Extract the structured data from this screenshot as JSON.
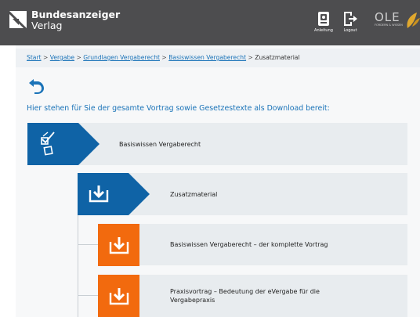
{
  "header": {
    "brand_line1": "Bundesanzeiger",
    "brand_line2": "Verlag",
    "anleitung_label": "Anleitung",
    "logout_label": "Logout",
    "ole_text": "OLE",
    "ole_sub": "FORDERN & WISSEN"
  },
  "breadcrumb": {
    "start": "Start",
    "vergabe": "Vergabe",
    "grundlagen": "Grundlagen Vergaberecht",
    "basiswissen": "Basiswissen Vergaberecht",
    "current": "Zusatzmaterial",
    "separator": ">"
  },
  "intro_text": "Hier stehen für Sie der gesamte Vortrag sowie Gesetzestexte als Download bereit:",
  "tree": {
    "level1_label": "Basiswissen Vergaberecht",
    "level2_label": "Zusatzmaterial",
    "items": [
      {
        "label": "Basiswissen Vergaberecht – der komplette Vortrag"
      },
      {
        "label": "Praxisvortrag – Bedeutung der eVergabe für die Vergabepraxis"
      }
    ]
  },
  "colors": {
    "header_bg": "#4d4d4f",
    "link": "#1a73b8",
    "tag_blue": "#0f63a6",
    "download_orange": "#f26a0e",
    "row_bg": "#e8ecef"
  },
  "icons": {
    "brand": "bundesanzeiger-logo-icon",
    "anleitung": "manual-icon",
    "logout": "logout-icon",
    "back": "back-arrow-icon",
    "checklist": "checklist-icon",
    "download": "download-icon"
  }
}
